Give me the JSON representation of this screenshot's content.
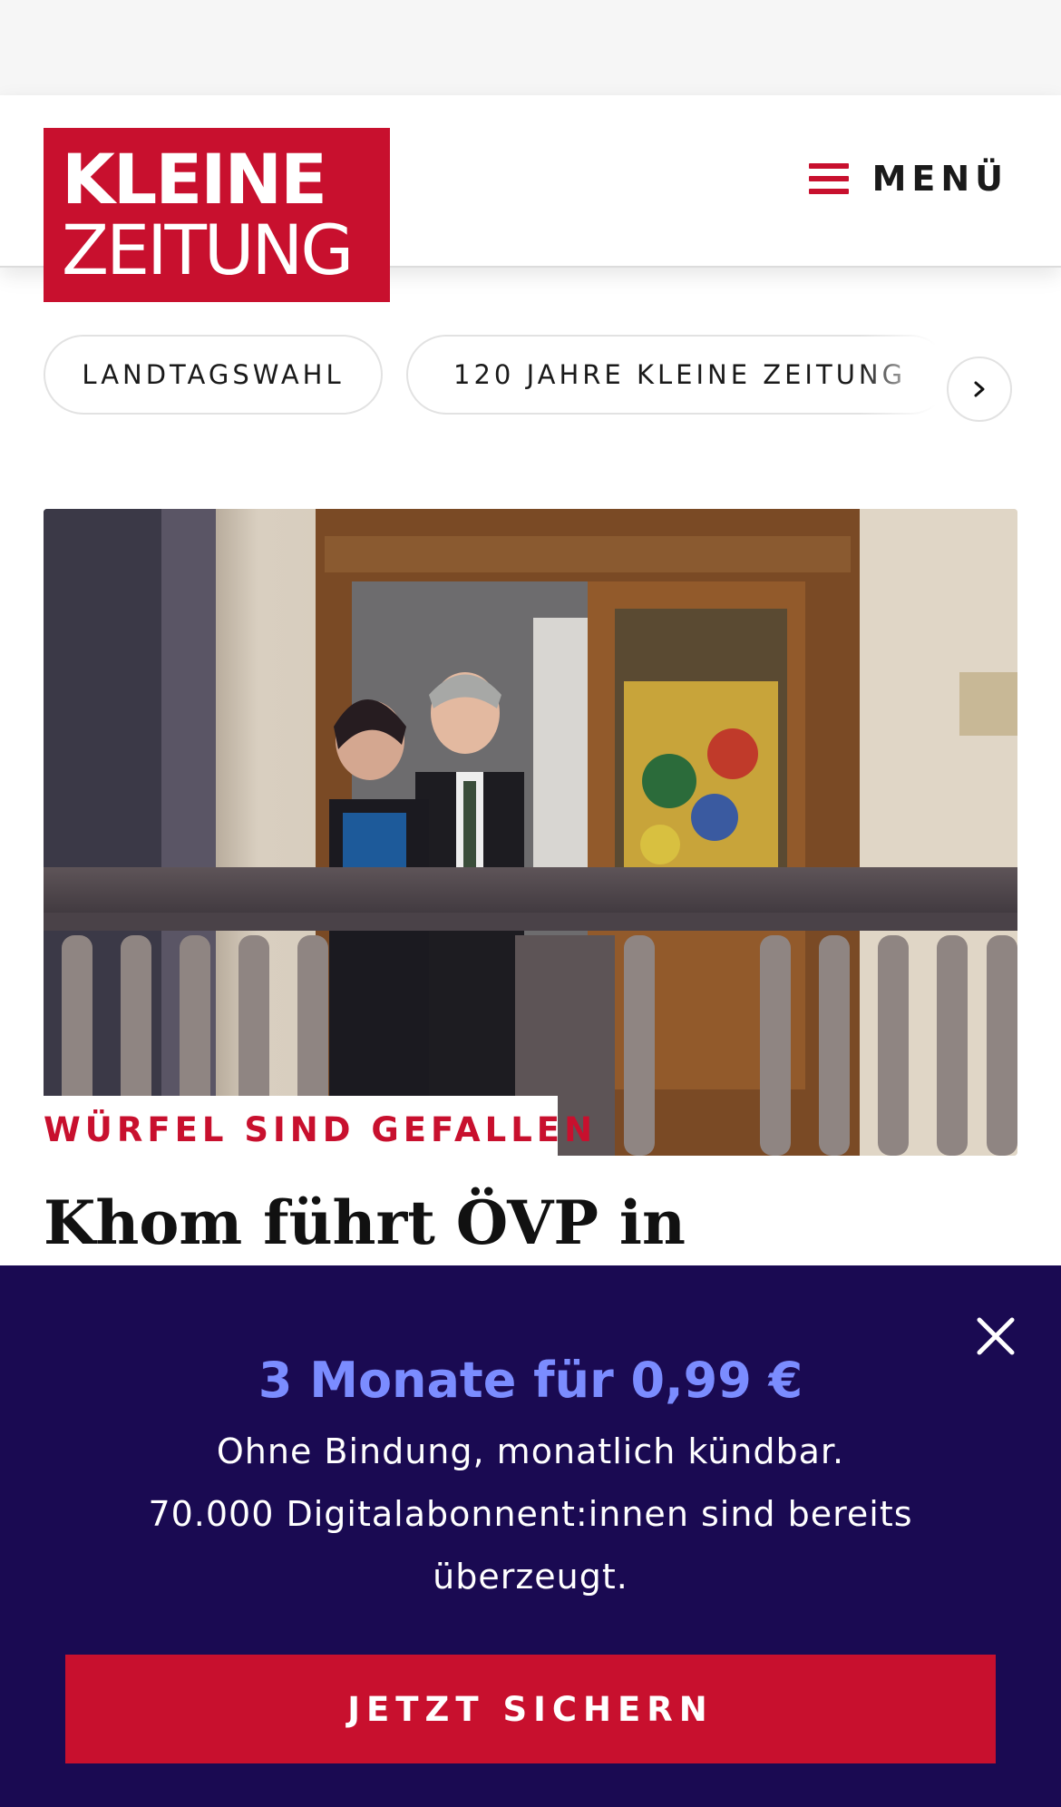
{
  "header": {
    "logo_line1": "KLEINE",
    "logo_line2": "ZEITUNG",
    "menu_label": "MENÜ"
  },
  "tags": [
    {
      "label": "LANDTAGSWAHL"
    },
    {
      "label": "120 JAHRE KLEINE ZEITUNG"
    }
  ],
  "article": {
    "kicker": "WÜRFEL SIND GEFALLEN",
    "headline": "Khom führt ÖVP in"
  },
  "offer": {
    "title": "3 Monate für 0,99 €",
    "line1": "Ohne Bindung, monatlich kündbar.",
    "line2": "70.000 Digitalabonnent:innen sind bereits",
    "line3": "überzeugt.",
    "cta_label": "JETZT SICHERN"
  },
  "colors": {
    "brand_red": "#c8102e",
    "overlay_bg": "#1a0a52",
    "offer_accent": "#7b8cff"
  },
  "icons": {
    "menu": "hamburger-icon",
    "tags_next": "chevron-right-icon",
    "overlay_close": "close-icon"
  }
}
